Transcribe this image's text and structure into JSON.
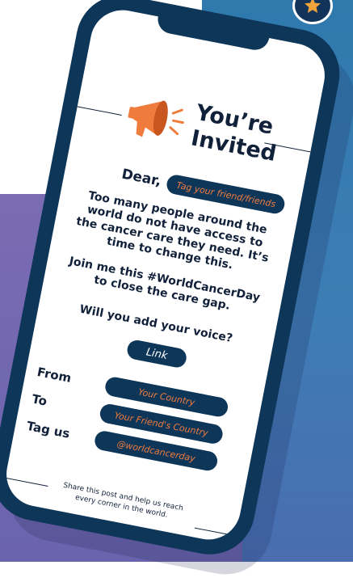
{
  "colors": {
    "phone_frame": "#0e3659",
    "accent_orange": "#ef7b3d",
    "background_blue": "#2f79ad",
    "background_purple": "#7a6cb3"
  },
  "icons": [
    "megaphone-icon",
    "star-icon"
  ],
  "invite": {
    "title_line1": "You’re",
    "title_line2": "Invited",
    "greeting": "Dear,",
    "tag_placeholder": "Tag your friend/friends"
  },
  "message": {
    "paragraph1": "Too many people around the world do not have access to the cancer care they need. It’s time to change this.",
    "paragraph2": "Join me this #WorldCancerDay to close the care gap.",
    "question": "Will you add your voice?"
  },
  "link_button": "Link",
  "form": {
    "from_label": "From",
    "from_value": "Your Country",
    "to_label": "To",
    "to_value": "Your Friend's Country",
    "tag_label": "Tag us",
    "tag_value": "@worldcancerday"
  },
  "footer": "Share this post and help us reach every corner in the world."
}
